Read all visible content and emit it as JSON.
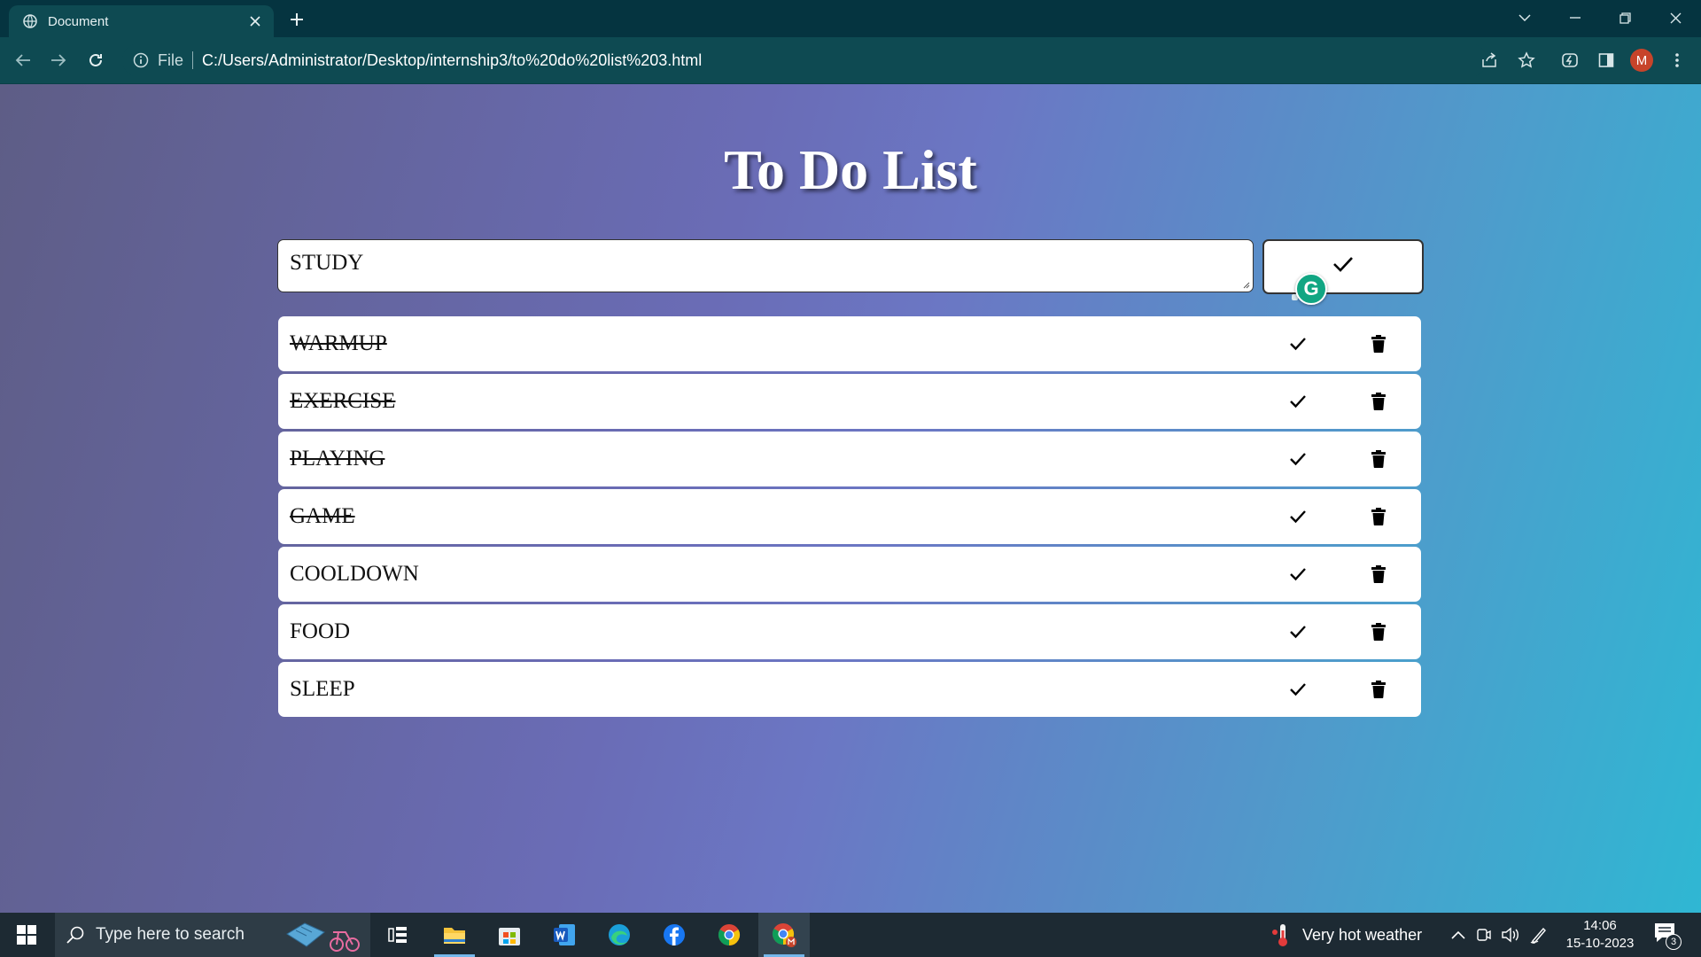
{
  "browser": {
    "tab_title": "Document",
    "url_scheme_label": "File",
    "url": "C:/Users/Administrator/Desktop/internship3/to%20do%20list%203.html",
    "profile_initial": "M"
  },
  "page": {
    "title": "To Do List",
    "input_value": "STUDY",
    "grammarly_letter": "G",
    "tasks": [
      {
        "text": "WARMUP",
        "completed": true
      },
      {
        "text": "EXERCISE",
        "completed": true
      },
      {
        "text": "PLAYING",
        "completed": true
      },
      {
        "text": "GAME",
        "completed": true
      },
      {
        "text": "COOLDOWN",
        "completed": false
      },
      {
        "text": "FOOD",
        "completed": false
      },
      {
        "text": "SLEEP",
        "completed": false
      }
    ]
  },
  "taskbar": {
    "search_placeholder": "Type here to search",
    "weather": "Very hot weather",
    "time": "14:06",
    "date": "15-10-2023",
    "notification_count": "3",
    "apps": [
      "task-view-icon",
      "file-explorer-icon",
      "microsoft-store-icon",
      "word-icon",
      "edge-icon",
      "facebook-icon",
      "chrome-icon",
      "chrome-profile-icon"
    ]
  },
  "colors": {
    "accent_green": "#11a683",
    "chrome_bg": "#0e4a52",
    "taskbar_bg": "#1d2a33"
  }
}
